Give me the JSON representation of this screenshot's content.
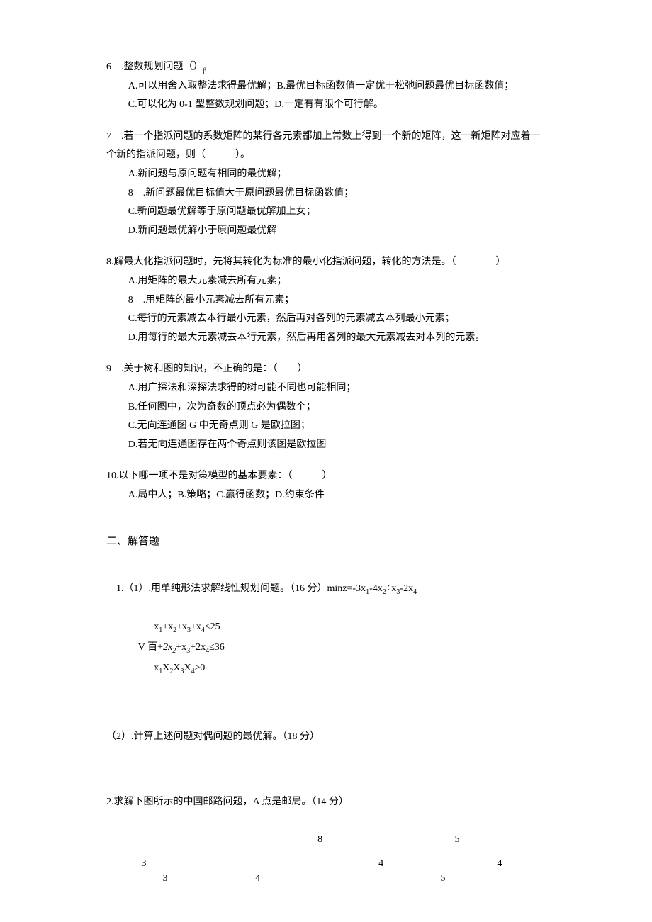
{
  "q6": {
    "stem": "6 .整数规划问题（）",
    "sub": "β",
    "a": "A.可以用舍入取整法求得最优解；B.最优目标函数值一定优于松弛问题最优目标函数值；",
    "c": "C.可以化为 0-1 型整数规划问题；D.一定有有限个可行解。"
  },
  "q7": {
    "stem": "7 .若一个指派问题的系数矩阵的某行各元素都加上常数上得到一个新的矩阵，这一新矩阵对应着一个新的指派问题，则（   ）。",
    "a": "A.新问题与原问题有相同的最优解；",
    "b": "8 .新问题最优目标值大于原问题最优目标函数值；",
    "c": "C.新问题最优解等于原问题最优解加上女；",
    "d": "D.新问题最优解小于原问题最优解"
  },
  "q8": {
    "stem": "8.解最大化指派问题时，先将其转化为标准的最小化指派问题，转化的方法是。（    ）",
    "a": "A.用矩阵的最大元素减去所有元素；",
    "b": "8 .用矩阵的最小元素减去所有元素；",
    "c": "C.每行的元素减去本行最小元素，然后再对各列的元素减去本列最小元素；",
    "d": "D.用每行的最大元素减去本行元素，然后再用各列的最大元素减去对本列的元素。"
  },
  "q9": {
    "stem": "9 .关于树和图的知识，不正确的是：（  ）",
    "a": "A.用广探法和深探法求得的树可能不同也可能相同；",
    "b": "B.任何图中，次为奇数的顶点必为偶数个；",
    "c": "C.无向连通图 G 中无奇点则 G 是欧拉图；",
    "d": "D.若无向连通图存在两个奇点则该图是欧拉图"
  },
  "q10": {
    "stem": "10.以下哪一项不是对策模型的基本要素：（   ）",
    "a": "A.局中人；B.策略；C.赢得函数；D.约束条件"
  },
  "sect2": "二、解答题",
  "p1": {
    "stem_pre": "1.（1）.用单纯形法求解线性规划问题。（16 分）minz=-3x",
    "s1": "1",
    "mid1": "-4x",
    "s2": "2",
    "mid2": "÷x",
    "s3": "3",
    "mid3": "-2x",
    "s4": "4",
    "c1_a": "x",
    "c1_b": "+x",
    "c1_c": "+x",
    "c1_d": "+x",
    "c1_e": "≤25",
    "c2_a": "V 百+",
    "c2_b": "2",
    "c2_c": "2",
    "c2_d": "+x",
    "c2_e": "+2x",
    "c2_f": "≤36",
    "c3": "x",
    "c3s": "1",
    "c3a": "X",
    "c3s2": "2",
    "c3b": "X",
    "c3s3": "3",
    "c3c": "X",
    "c3s4": "4",
    "c3d": "≥0",
    "italic_x": "x"
  },
  "p1_2": "（2）.计算上述问题对偶问题的最优解。（18 分）",
  "p2": "2.求解下图所示的中国邮路问题，A 点是邮局。（14 分）",
  "graph": {
    "r1": [
      "",
      "8",
      "",
      "5"
    ],
    "r2": [
      "3",
      "",
      "4",
      "4"
    ],
    "r3": [
      "3",
      "4",
      "",
      "5"
    ]
  }
}
